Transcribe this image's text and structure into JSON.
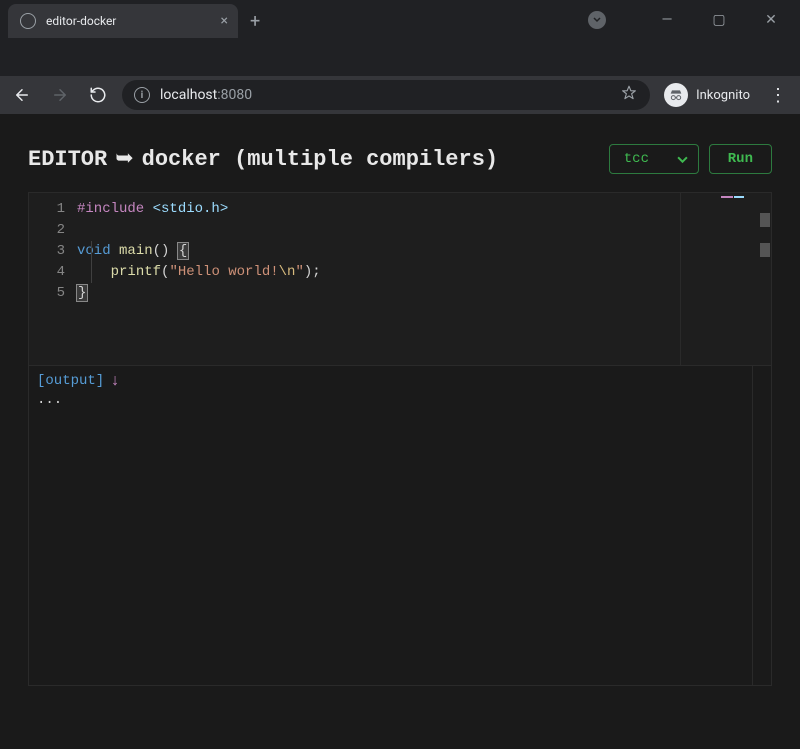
{
  "browser": {
    "tab_title": "editor-docker",
    "url_host": "localhost",
    "url_port": ":8080",
    "profile_label": "Inkognito"
  },
  "page": {
    "title_prefix": "EDITOR",
    "title_arrow": "➥",
    "title_suffix": "docker (multiple compilers)",
    "compiler_selected": "tcc",
    "run_label": "Run"
  },
  "code": {
    "line_numbers": [
      "1",
      "2",
      "3",
      "4",
      "5"
    ],
    "l1_pp": "#include",
    "l1_sp": " ",
    "l1_inc": "<stdio.h>",
    "l3_kw": "void",
    "l3_sp": " ",
    "l3_fn": "main",
    "l3_paren": "() ",
    "l3_brace": "{",
    "l4_indent": "    ",
    "l4_fn": "printf",
    "l4_open": "(",
    "l4_str1": "\"Hello world!",
    "l4_esc": "\\n",
    "l4_str2": "\"",
    "l4_close": ");",
    "l5_brace": "}"
  },
  "output": {
    "label": "[output]",
    "arrow": "↓",
    "body": "..."
  }
}
